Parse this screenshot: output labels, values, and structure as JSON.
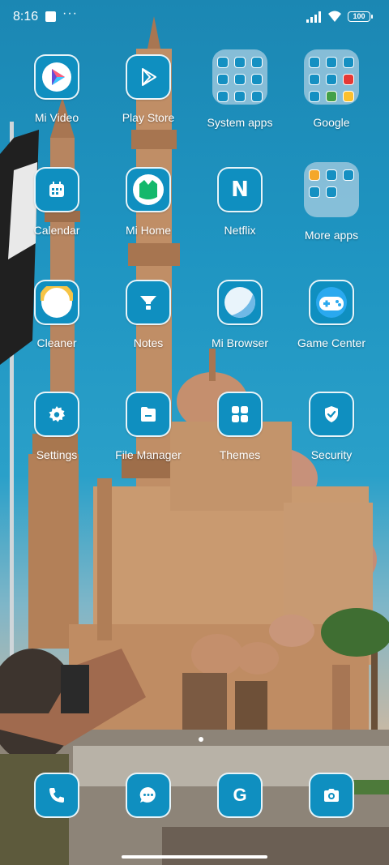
{
  "status_bar": {
    "time": "8:16",
    "overflow": "···",
    "battery": "100"
  },
  "apps": [
    {
      "id": "mi-video",
      "label": "Mi Video",
      "icon": "play-icon"
    },
    {
      "id": "play-store",
      "label": "Play Store",
      "icon": "play-store-icon"
    },
    {
      "id": "system-apps",
      "label": "System apps",
      "icon": "folder-icon"
    },
    {
      "id": "google",
      "label": "Google",
      "icon": "folder-icon"
    },
    {
      "id": "calendar",
      "label": "Calendar",
      "icon": "calendar-icon"
    },
    {
      "id": "mi-home",
      "label": "Mi Home",
      "icon": "home-icon"
    },
    {
      "id": "netflix",
      "label": "Netflix",
      "icon": "netflix-icon",
      "glyph": "N"
    },
    {
      "id": "more-apps",
      "label": "More apps",
      "icon": "folder-icon"
    },
    {
      "id": "cleaner",
      "label": "Cleaner",
      "icon": "cleaner-icon"
    },
    {
      "id": "notes",
      "label": "Notes",
      "icon": "notes-icon"
    },
    {
      "id": "mi-browser",
      "label": "Mi Browser",
      "icon": "browser-icon"
    },
    {
      "id": "game-center",
      "label": "Game Center",
      "icon": "gamepad-icon"
    },
    {
      "id": "settings",
      "label": "Settings",
      "icon": "gear-icon"
    },
    {
      "id": "file-manager",
      "label": "File Manager",
      "icon": "file-icon"
    },
    {
      "id": "themes",
      "label": "Themes",
      "icon": "grid-icon"
    },
    {
      "id": "security",
      "label": "Security",
      "icon": "shield-icon"
    }
  ],
  "dock": [
    {
      "id": "phone",
      "icon": "phone-icon"
    },
    {
      "id": "messages",
      "icon": "chat-icon"
    },
    {
      "id": "google-search",
      "icon": "google-icon",
      "glyph": "G"
    },
    {
      "id": "camera",
      "icon": "camera-icon"
    }
  ],
  "colors": {
    "tile": "#0f8fc0",
    "sky": "#1f95c2",
    "stone": "#c79a72"
  }
}
